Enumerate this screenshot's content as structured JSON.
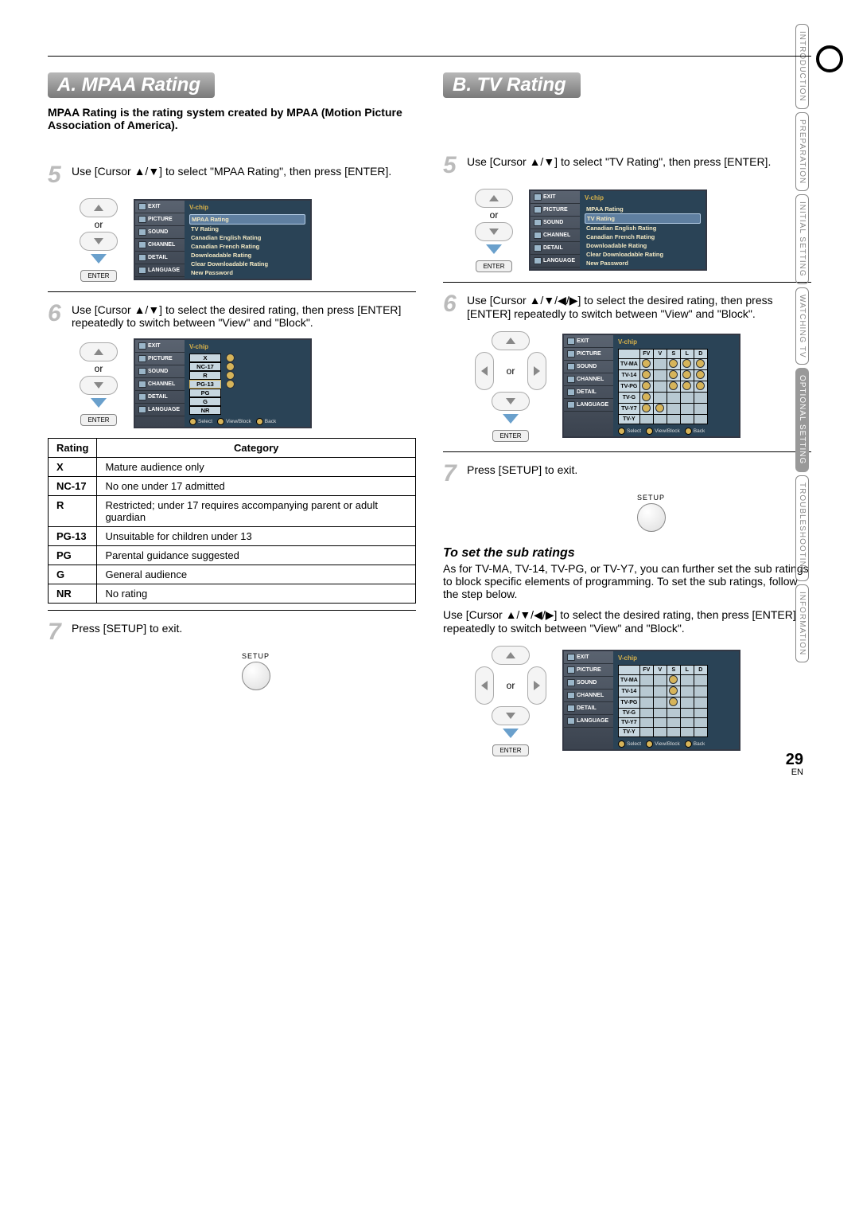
{
  "page_number": "29",
  "page_lang": "EN",
  "side_tabs": [
    "INTRODUCTION",
    "PREPARATION",
    "INITIAL SETTING",
    "WATCHING TV",
    "OPTIONAL SETTING",
    "TROUBLESHOOTING",
    "INFORMATION"
  ],
  "active_tab_index": 4,
  "section_a": {
    "title": "A.  MPAA Rating",
    "intro": "MPAA Rating is the rating system created by MPAA (Motion Picture Association of America).",
    "step5": "Use [Cursor ▲/▼] to select \"MPAA Rating\", then press [ENTER].",
    "step6": "Use [Cursor ▲/▼] to select the desired rating, then press [ENTER] repeatedly to switch between \"View\" and \"Block\".",
    "step7": "Press [SETUP] to exit."
  },
  "section_b": {
    "title": "B.  TV Rating",
    "step5": "Use [Cursor ▲/▼] to select \"TV Rating\", then press [ENTER].",
    "step6": "Use [Cursor ▲/▼/◀/▶] to select the desired rating, then press [ENTER] repeatedly to switch between \"View\" and \"Block\".",
    "step7": "Press [SETUP] to exit.",
    "subratings_heading": "To set the sub ratings",
    "subratings_body": "As for TV-MA, TV-14, TV-PG, or TV-Y7, you can further set the sub ratings to block specific elements of programming. To set the sub ratings, follow the step below.",
    "subratings_step": "Use [Cursor ▲/▼/◀/▶] to select the desired rating, then press [ENTER] repeatedly to switch between \"View\" and \"Block\"."
  },
  "labels": {
    "or": "or",
    "enter": "ENTER",
    "setup": "SETUP"
  },
  "osd": {
    "sidebar": [
      "EXIT",
      "PICTURE",
      "SOUND",
      "CHANNEL",
      "DETAIL",
      "LANGUAGE"
    ],
    "title": "V-chip",
    "menu_items": [
      "MPAA Rating",
      "TV Rating",
      "Canadian English Rating",
      "Canadian French Rating",
      "Downloadable Rating",
      "Clear Downloadable Rating",
      "New Password"
    ],
    "statusbar": {
      "select": "Select",
      "viewblock": "View/Block",
      "back": "Back"
    },
    "mpaa_ratings": [
      "X",
      "NC-17",
      "R",
      "PG-13",
      "PG",
      "G",
      "NR"
    ],
    "tv_headers": [
      "FV",
      "V",
      "S",
      "L",
      "D"
    ],
    "tv_rows": [
      "TV-MA",
      "TV-14",
      "TV-PG",
      "TV-G",
      "TV-Y7",
      "TV-Y"
    ]
  },
  "rating_table": {
    "headers": [
      "Rating",
      "Category"
    ],
    "rows": [
      [
        "X",
        "Mature audience only"
      ],
      [
        "NC-17",
        "No one under 17 admitted"
      ],
      [
        "R",
        "Restricted; under 17 requires accompanying parent or adult guardian"
      ],
      [
        "PG-13",
        "Unsuitable for children under 13"
      ],
      [
        "PG",
        "Parental guidance suggested"
      ],
      [
        "G",
        "General audience"
      ],
      [
        "NR",
        "No rating"
      ]
    ]
  }
}
